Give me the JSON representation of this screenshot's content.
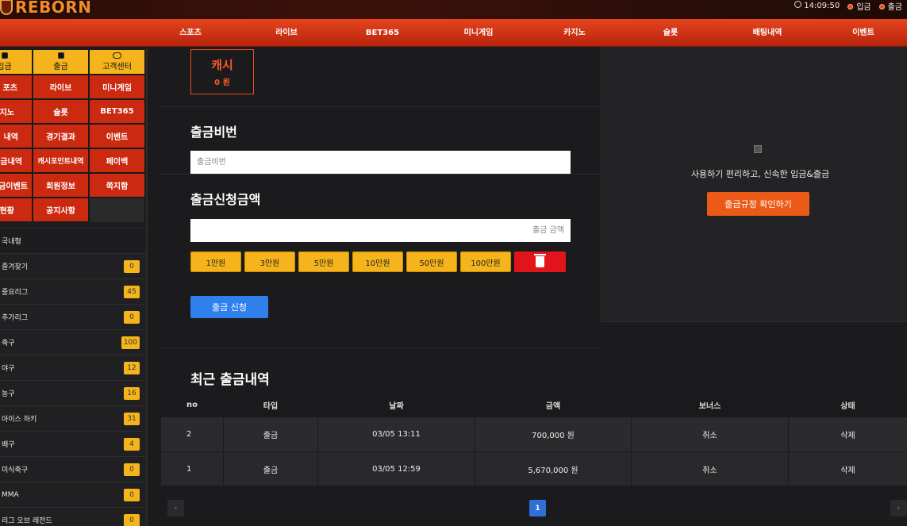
{
  "header": {
    "logo": "REBORN",
    "time": "14:09:50",
    "deposit_link": "입금",
    "withdraw_link": "출금"
  },
  "nav": [
    "스포츠",
    "라이브",
    "BET365",
    "미니게임",
    "카지노",
    "슬롯",
    "배팅내역",
    "이벤트"
  ],
  "quick": {
    "deposit": "입금",
    "withdraw": "출금",
    "support": "고객센터",
    "grid": [
      [
        "포츠",
        "라이브",
        "미니게임"
      ],
      [
        "지노",
        "슬롯",
        "BET365"
      ],
      [
        "내역",
        "경기결과",
        "이벤트"
      ],
      [
        "금내역",
        "캐시포인트내역",
        "페이백"
      ],
      [
        "금이벤트",
        "회원정보",
        "쪽지함"
      ],
      [
        "현황",
        "공지사항",
        ""
      ]
    ]
  },
  "leagues": {
    "header": "국내형",
    "items": [
      {
        "name": "즐겨찾기",
        "count": "0"
      },
      {
        "name": "중요리그",
        "count": "45"
      },
      {
        "name": "추가리그",
        "count": "0"
      },
      {
        "name": "축구",
        "count": "100"
      },
      {
        "name": "야구",
        "count": "12"
      },
      {
        "name": "농구",
        "count": "16"
      },
      {
        "name": "아이스 하키",
        "count": "31"
      },
      {
        "name": "배구",
        "count": "4"
      },
      {
        "name": "미식축구",
        "count": "0"
      },
      {
        "name": "MMA",
        "count": "0"
      },
      {
        "name": "리그 오브 레전드",
        "count": "0"
      }
    ]
  },
  "cash": {
    "label": "캐시",
    "value": "0 원"
  },
  "pin": {
    "title": "출금비번",
    "placeholder": "출금비번"
  },
  "amount": {
    "title": "출금신청금액",
    "placeholder": "출금 금액",
    "buttons": [
      "1만원",
      "3만원",
      "5만원",
      "10만원",
      "50만원",
      "100만원"
    ]
  },
  "submit_label": "출금 신청",
  "right_panel": {
    "text": "사용하기 편리하고, 신속한 입금&출금",
    "button": "출금규정 확인하기"
  },
  "history": {
    "title": "최근 출금내역",
    "columns": [
      "no",
      "타입",
      "날짜",
      "금액",
      "보너스",
      "상태"
    ],
    "rows": [
      [
        "2",
        "출금",
        "03/05 13:11",
        "700,000 원",
        "취소",
        "삭제"
      ],
      [
        "1",
        "출금",
        "03/05 12:59",
        "5,670,000 원",
        "취소",
        "삭제"
      ]
    ]
  },
  "pager": {
    "prev": "‹",
    "current": "1",
    "next": "›"
  },
  "colors": {
    "accent": "#e5441f",
    "yellow": "#f5b41b",
    "blue": "#2f80ed",
    "trash": "#e0141a"
  }
}
